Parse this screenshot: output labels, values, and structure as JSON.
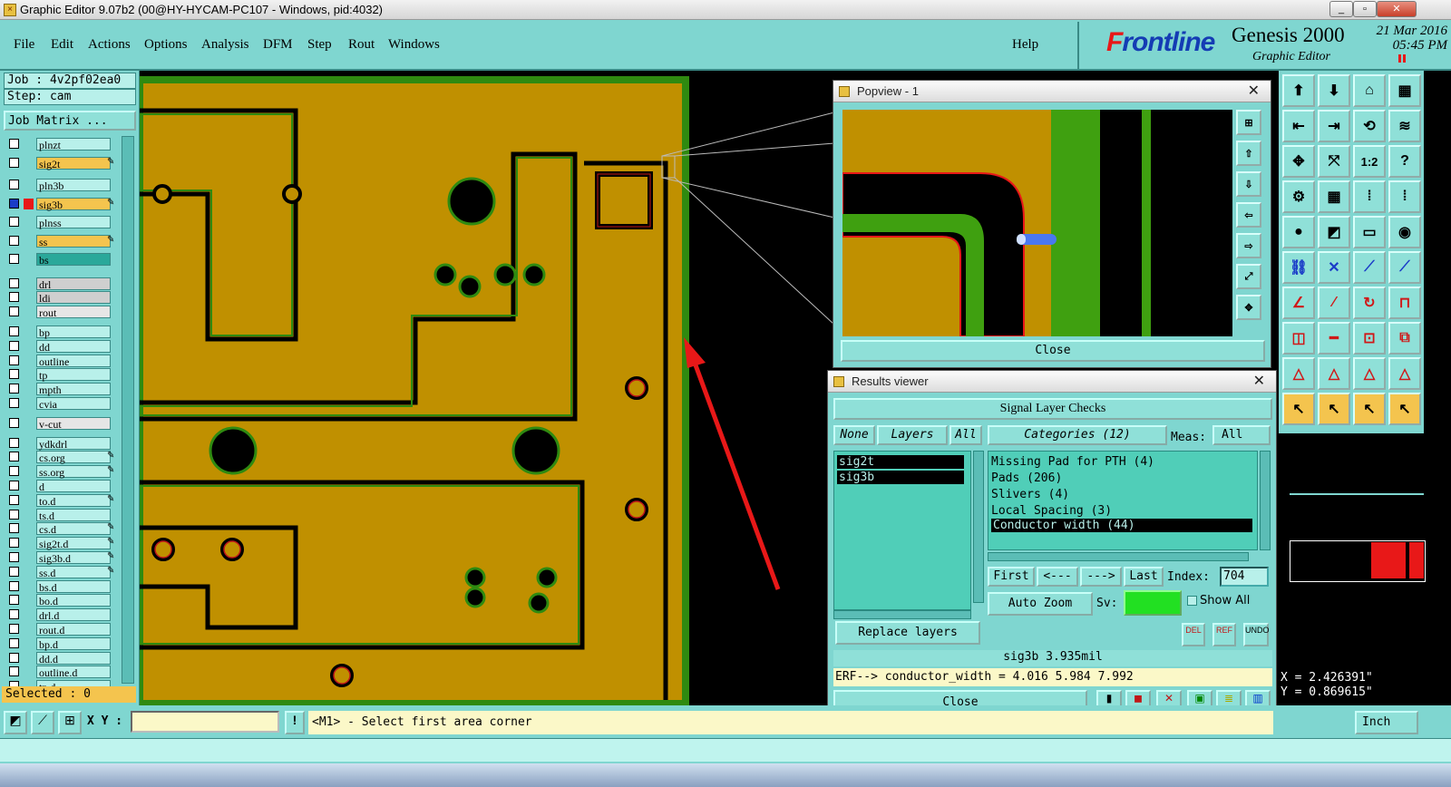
{
  "window": {
    "title": "Graphic Editor 9.07b2 (00@HY-HYCAM-PC107 - Windows, pid:4032)",
    "min": "_",
    "max": "▫",
    "close": "✕"
  },
  "menu": {
    "items": [
      "File",
      "Edit",
      "Actions",
      "Options",
      "Analysis",
      "DFM",
      "Step",
      "Rout",
      "Windows"
    ],
    "help": "Help"
  },
  "brand": {
    "logo_a": "F",
    "logo_b": "rontline",
    "product": "Genesis 2000",
    "subtitle": "Graphic Editor",
    "date": "21 Mar 2016",
    "time": "05:45 PM"
  },
  "job": {
    "job": "Job : 4v2pf02ea0",
    "step": "Step: cam",
    "matrix": "Job Matrix ..."
  },
  "layers": [
    {
      "name": "plnzt",
      "color": "#b8f0ea",
      "edit": ""
    },
    {
      "name": "sig2t",
      "color": "#f4c44e",
      "edit": "✎"
    },
    {
      "name": "pln3b",
      "color": "#b8f0ea",
      "edit": ""
    },
    {
      "name": "sig3b",
      "color": "#f4c44e",
      "edit": "✎"
    },
    {
      "name": "plnss",
      "color": "#b8f0ea",
      "edit": ""
    },
    {
      "name": "ss",
      "color": "#f4c44e",
      "edit": "✎"
    },
    {
      "name": "bs",
      "color": "#2aa89a",
      "edit": ""
    },
    {
      "name": "drl",
      "color": "#cfcfcf",
      "edit": ""
    },
    {
      "name": "ldi",
      "color": "#cfcfcf",
      "edit": ""
    },
    {
      "name": "rout",
      "color": "#e6e6e6",
      "edit": ""
    },
    {
      "name": "bp",
      "color": "#b8f0ea",
      "edit": ""
    },
    {
      "name": "dd",
      "color": "#b8f0ea",
      "edit": ""
    },
    {
      "name": "outline",
      "color": "#b8f0ea",
      "edit": ""
    },
    {
      "name": "tp",
      "color": "#b8f0ea",
      "edit": ""
    },
    {
      "name": "mpth",
      "color": "#b8f0ea",
      "edit": ""
    },
    {
      "name": "cvia",
      "color": "#b8f0ea",
      "edit": ""
    },
    {
      "name": "v-cut",
      "color": "#e6e6e6",
      "edit": ""
    },
    {
      "name": "ydkdrl",
      "color": "#b8f0ea",
      "edit": ""
    },
    {
      "name": "cs.org",
      "color": "#b8f0ea",
      "edit": "✎"
    },
    {
      "name": "ss.org",
      "color": "#b8f0ea",
      "edit": "✎"
    },
    {
      "name": "d",
      "color": "#b8f0ea",
      "edit": ""
    },
    {
      "name": "to.d",
      "color": "#b8f0ea",
      "edit": "✎"
    },
    {
      "name": "ts.d",
      "color": "#b8f0ea",
      "edit": ""
    },
    {
      "name": "cs.d",
      "color": "#b8f0ea",
      "edit": "✎"
    },
    {
      "name": "sig2t.d",
      "color": "#b8f0ea",
      "edit": "✎"
    },
    {
      "name": "sig3b.d",
      "color": "#b8f0ea",
      "edit": "✎"
    },
    {
      "name": "ss.d",
      "color": "#b8f0ea",
      "edit": "✎"
    },
    {
      "name": "bs.d",
      "color": "#b8f0ea",
      "edit": ""
    },
    {
      "name": "bo.d",
      "color": "#b8f0ea",
      "edit": ""
    },
    {
      "name": "drl.d",
      "color": "#b8f0ea",
      "edit": ""
    },
    {
      "name": "rout.d",
      "color": "#b8f0ea",
      "edit": ""
    },
    {
      "name": "bp.d",
      "color": "#b8f0ea",
      "edit": ""
    },
    {
      "name": "dd.d",
      "color": "#b8f0ea",
      "edit": ""
    },
    {
      "name": "outline.d",
      "color": "#b8f0ea",
      "edit": ""
    },
    {
      "name": "tp.d",
      "color": "#b8f0ea",
      "edit": ""
    }
  ],
  "selected": "Selected : 0",
  "popview": {
    "title": "Popview - 1",
    "close": "Close",
    "close_x": "✕"
  },
  "results": {
    "title": "Results viewer",
    "close_x": "✕",
    "heading": "Signal Layer Checks",
    "none": "None",
    "layers": "Layers",
    "all": "All",
    "categories": "Categories (12)",
    "meas": "Meas:",
    "meas_val": "All",
    "layer_list": [
      "sig2t",
      "sig3b"
    ],
    "cat_list": [
      "Missing Pad for PTH (4)",
      "Pads (206)",
      "Slivers (4)",
      "Local Spacing (3)",
      "Conductor width (44)"
    ],
    "first": "First",
    "prev": "<---",
    "next": "--->",
    "last": "Last",
    "index_label": "Index:",
    "index_val": "704",
    "autozoom": "Auto Zoom",
    "sv": "Sv:",
    "showall": "Show All",
    "replace": "Replace layers",
    "del": "DEL",
    "ref": "REF",
    "undo": "UNDO",
    "status": "sig3b 3.935mil",
    "erf": "ERF--> conductor_width = 4.016 5.984 7.992",
    "close": "Close"
  },
  "bottom": {
    "xy_label": "X Y :",
    "prompt": "<M1> - Select first area corner",
    "unit": "Inch"
  },
  "coords": {
    "x": "X = 2.426391\"",
    "y": "Y = 0.869615\""
  },
  "toolbox": {
    "ratio": "1:2",
    "question": "?"
  }
}
